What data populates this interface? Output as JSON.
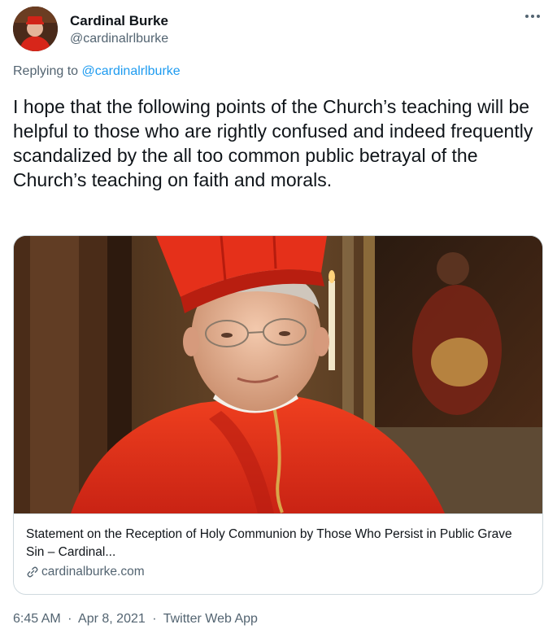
{
  "author": {
    "name": "Cardinal Burke",
    "handle": "@cardinalrlburke",
    "more_icon": "more-horizontal-icon"
  },
  "reply": {
    "prefix": "Replying to",
    "handle": "@cardinalrlburke"
  },
  "tweet": {
    "text": "I hope that the following points of the Church’s teaching will be helpful to those who are rightly confused and indeed frequently scandalized by the all too common public betrayal of the Church’s teaching on faith and morals."
  },
  "card": {
    "title": "Statement on the Reception of Holy Communion by Those Who Persist in Public Grave Sin – Cardinal...",
    "domain": "cardinalburke.com",
    "domain_icon": "link-icon"
  },
  "meta": {
    "time": "6:45 AM",
    "date": "Apr 8, 2021",
    "source": "Twitter Web App",
    "separator": "·"
  },
  "colors": {
    "text": "#0f1419",
    "secondary": "#536471",
    "link": "#1d9bf0",
    "border": "#cfd9de",
    "vestment_red": "#e8321e"
  }
}
